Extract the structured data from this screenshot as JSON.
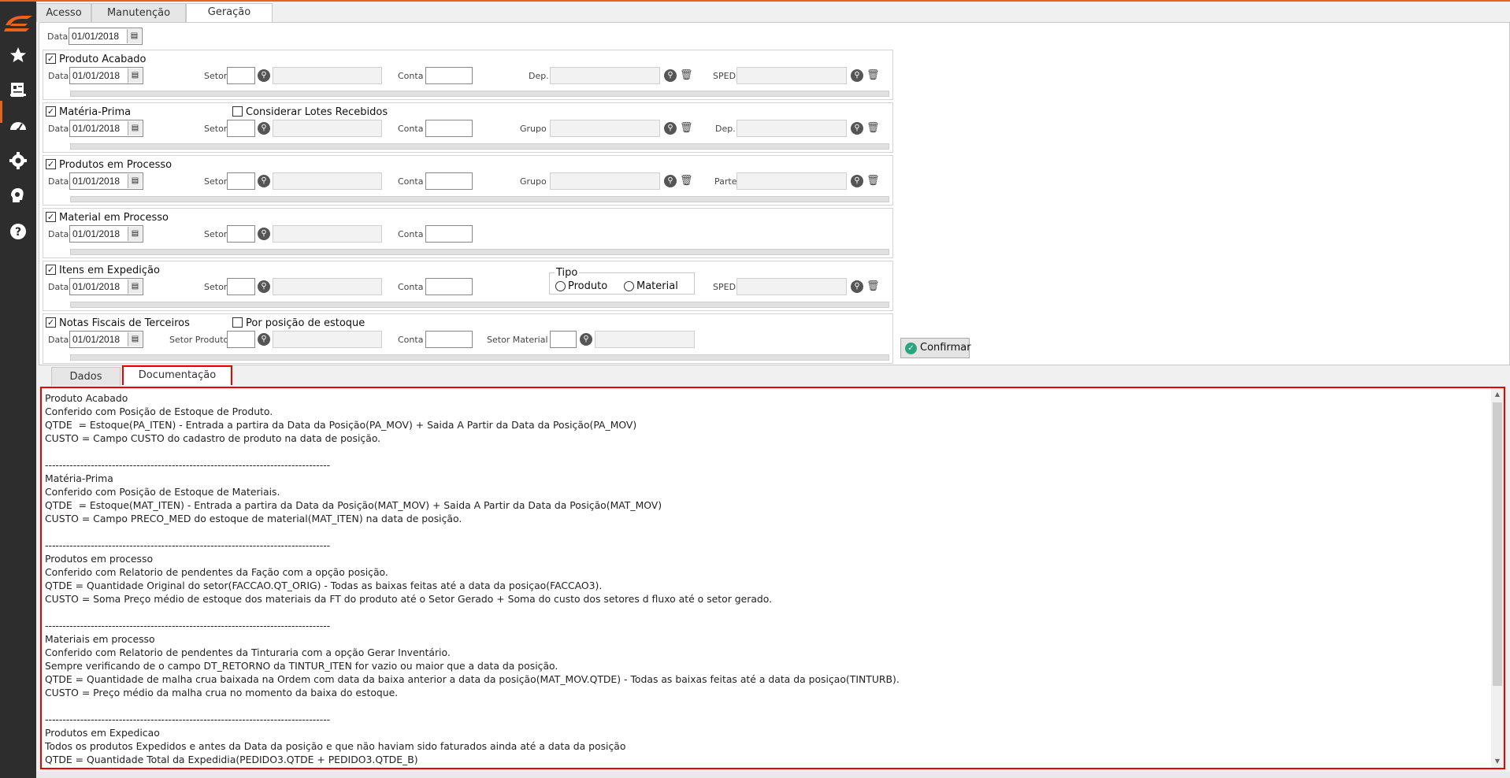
{
  "colors": {
    "accent": "#e8631c",
    "sidebar": "#2d2d2d",
    "highlight": "#ee0000"
  },
  "sidebar": {
    "items": [
      {
        "name": "favorites",
        "icon": "star-icon"
      },
      {
        "name": "reports",
        "icon": "report-icon"
      },
      {
        "name": "dashboard",
        "icon": "gauge-icon"
      },
      {
        "name": "settings",
        "icon": "gear-icon"
      },
      {
        "name": "profile",
        "icon": "head-gear-icon"
      },
      {
        "name": "help",
        "icon": "help-icon"
      }
    ]
  },
  "top_tabs": [
    "Acesso",
    "Manutenção",
    "Geração"
  ],
  "header": {
    "data_label": "Data",
    "data_value": "01/01/2018"
  },
  "sections": {
    "produto_acabado": {
      "title": "Produto Acabado",
      "data_label": "Data",
      "date": "01/01/2018",
      "setor": "Setor",
      "conta": "Conta",
      "dep": "Dep.",
      "sped": "SPED"
    },
    "materia_prima": {
      "title": "Matéria-Prima",
      "lotes": "Considerar Lotes Recebidos",
      "data_label": "Data",
      "date": "01/01/2018",
      "setor": "Setor",
      "conta": "Conta",
      "grupo": "Grupo",
      "dep": "Dep."
    },
    "produtos_processo": {
      "title": "Produtos em Processo",
      "data_label": "Data",
      "date": "01/01/2018",
      "setor": "Setor",
      "conta": "Conta",
      "grupo": "Grupo",
      "parte": "Parte"
    },
    "material_processo": {
      "title": "Material em Processo",
      "data_label": "Data",
      "date": "01/01/2018",
      "setor": "Setor",
      "conta": "Conta"
    },
    "itens_expedicao": {
      "title": "Itens em Expedição",
      "data_label": "Data",
      "date": "01/01/2018",
      "setor": "Setor",
      "conta": "Conta",
      "tipo": "Tipo",
      "produto": "Produto",
      "material": "Material",
      "sped": "SPED"
    },
    "notas_fiscais": {
      "title": "Notas Fiscais de Terceiros",
      "posicao": "Por posição de estoque",
      "data_label": "Data",
      "date": "01/01/2018",
      "setor_produto": "Setor Produto",
      "conta": "Conta",
      "setor_material": "Setor Material"
    }
  },
  "confirm_label": "Confirmar",
  "bottom_tabs": [
    "Dados",
    "Documentação"
  ],
  "doc_lines": [
    "Produto Acabado",
    "Conferido com Posição de Estoque de Produto.",
    "QTDE  = Estoque(PA_ITEN) - Entrada a partira da Data da Posição(PA_MOV) + Saida A Partir da Data da Posição(PA_MOV)",
    "CUSTO = Campo CUSTO do cadastro de produto na data de posição.",
    "",
    "---------------------------------------------------------------------------------",
    "Matéria-Prima",
    "Conferido com Posição de Estoque de Materiais.",
    "QTDE  = Estoque(MAT_ITEN) - Entrada a partira da Data da Posição(MAT_MOV) + Saida A Partir da Data da Posição(MAT_MOV)",
    "CUSTO = Campo PRECO_MED do estoque de material(MAT_ITEN) na data de posição.",
    "",
    "---------------------------------------------------------------------------------",
    "Produtos em processo",
    "Conferido com Relatorio de pendentes da Fação com a opção posição.",
    "QTDE = Quantidade Original do setor(FACCAO.QT_ORIG) - Todas as baixas feitas até a data da posiçao(FACCAO3).",
    "CUSTO = Soma Preço médio de estoque dos materiais da FT do produto até o Setor Gerado + Soma do custo dos setores d fluxo até o setor gerado.",
    "",
    "---------------------------------------------------------------------------------",
    "Materiais em processo",
    "Conferido com Relatorio de pendentes da Tinturaria com a opção Gerar Inventário.",
    "Sempre verificando de o campo DT_RETORNO da TINTUR_ITEN for vazio ou maior que a data da posição.",
    "QTDE = Quantidade de malha crua baixada na Ordem com data da baixa anterior a data da posição(MAT_MOV.QTDE) - Todas as baixas feitas até a data da posiçao(TINTURB).",
    "CUSTO = Preço médio da malha crua no momento da baixa do estoque.",
    "",
    "---------------------------------------------------------------------------------",
    "Produtos em Expedicao",
    "Todos os produtos Expedidos e antes da Data da posição e que não haviam sido faturados ainda até a data da posição",
    "QTDE = Quantidade Total da Expedidia(PEDIDO3.QTDE + PEDIDO3.QTDE_B)"
  ]
}
